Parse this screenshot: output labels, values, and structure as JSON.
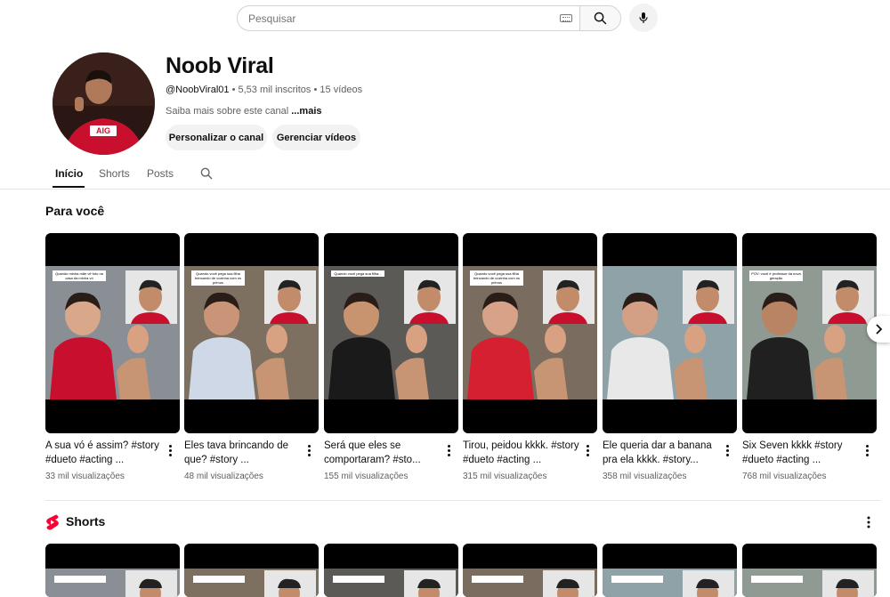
{
  "search": {
    "placeholder": "Pesquisar"
  },
  "channel": {
    "name": "Noob Viral",
    "handle": "@NoobViral01",
    "subscribers": "5,53 mil inscritos",
    "videos": "15 vídeos",
    "about": "Saiba mais sobre este canal",
    "about_more": "...mais",
    "btn_customize": "Personalizar o canal",
    "btn_manage": "Gerenciar vídeos"
  },
  "tabs": [
    "Início",
    "Shorts",
    "Posts"
  ],
  "section_for_you": "Para você",
  "section_shorts": "Shorts",
  "videos": [
    {
      "title": "A sua vó é assim? #story #dueto #acting ...",
      "views": "33 mil visualizações",
      "caption": "Quando minha mãe vê foto na casa da minha vó"
    },
    {
      "title": "Eles tava brincando de que?            #story ...",
      "views": "48 mil visualizações",
      "caption": "Quando você pega sua filha brincando de cozinha com os primos"
    },
    {
      "title": "Será que eles se comportaram?      #sto...",
      "views": "155 mil visualizações",
      "caption": "Quando você pega sua filha..."
    },
    {
      "title": "Tirou, peidou kkkk. #story #dueto #acting ...",
      "views": "315 mil visualizações",
      "caption": "Quando você pega sua filha brincando de cozinha com os primos"
    },
    {
      "title": "Ele queria dar a banana pra ela kkkk.       #story...",
      "views": "358 mil visualizações",
      "caption": ""
    },
    {
      "title": "Six Seven kkkk #story #dueto #acting ...",
      "views": "768 mil visualizações",
      "caption": "POV: você é professor da nova geração"
    }
  ],
  "colors": {
    "shirt_colors": [
      "#c8102e",
      "#cfd8e6",
      "#1a1a1a",
      "#d42030",
      "#e8e8e8",
      "#202020"
    ],
    "shorts_icon": "#ff0033"
  }
}
